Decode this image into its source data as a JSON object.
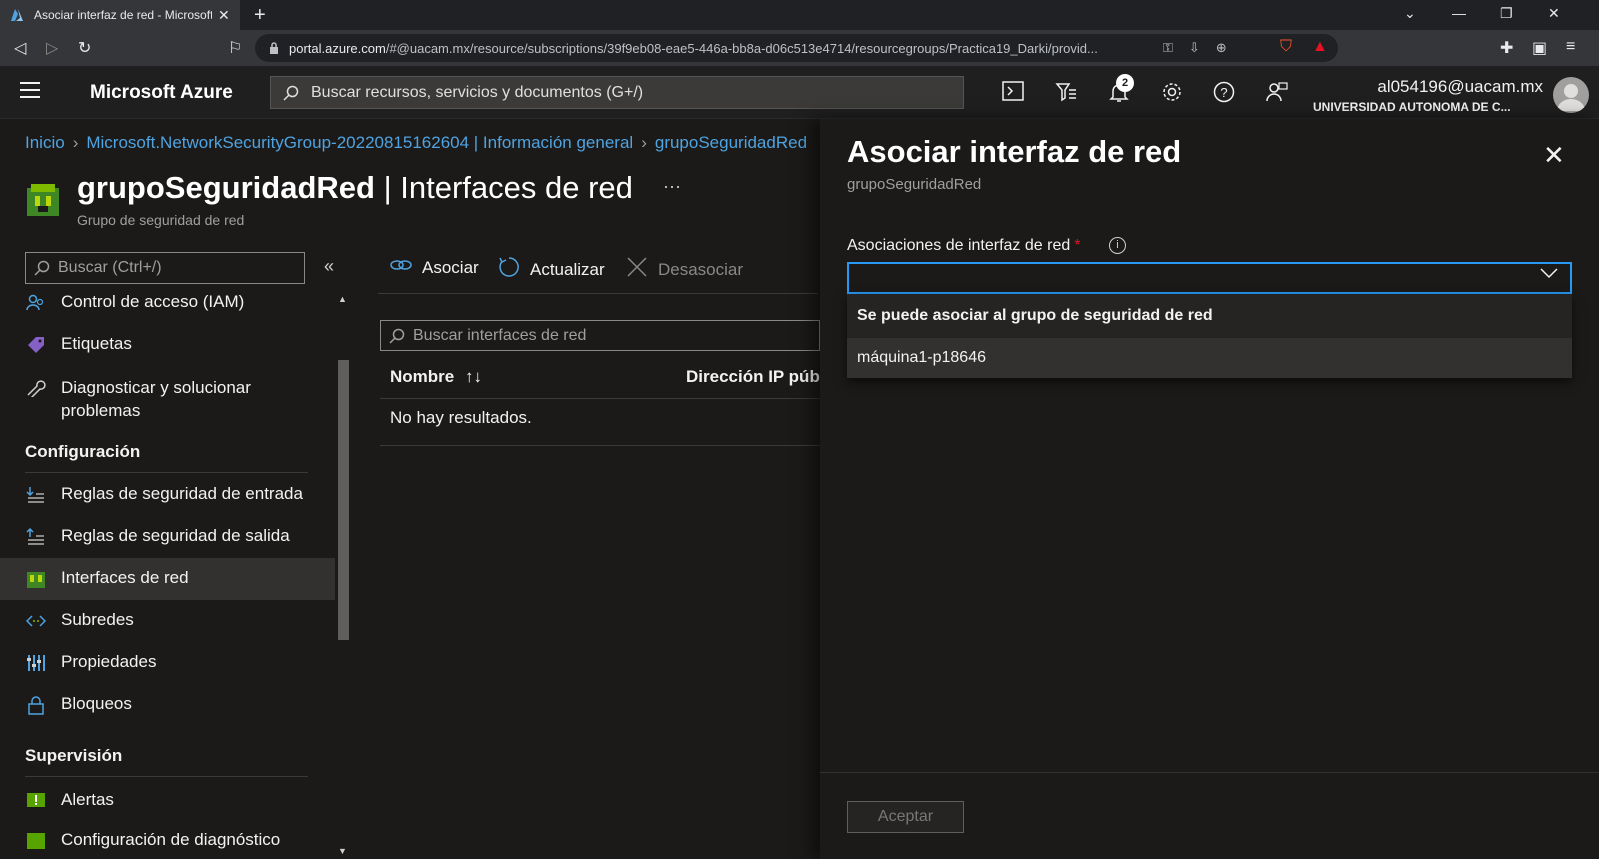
{
  "browser": {
    "tab_title": "Asociar interfaz de red - Microsoft Azure",
    "url_host": "portal.azure.com",
    "url_rest": "/#@uacam.mx/resource/subscriptions/39f9eb08-eae5-446a-bb8a-d06c513e4714/resourcegroups/Practica19_Darki/provid..."
  },
  "header": {
    "brand": "Microsoft Azure",
    "search_placeholder": "Buscar recursos, servicios y documentos (G+/)",
    "notifications_count": "2",
    "user_email": "al054196@uacam.mx",
    "user_org": "UNIVERSIDAD AUTONOMA DE C..."
  },
  "breadcrumb": {
    "items": [
      "Inicio",
      "Microsoft.NetworkSecurityGroup-20220815162604 | Información general",
      "grupoSeguridadRed"
    ]
  },
  "page": {
    "title_bold": "grupoSeguridadRed",
    "title_rest": " | Interfaces de red",
    "subtitle": "Grupo de seguridad de red",
    "more": "···"
  },
  "nav": {
    "search_placeholder": "Buscar (Ctrl+/)",
    "items": {
      "iam": "Control de acceso (IAM)",
      "tags": "Etiquetas",
      "diagnose": "Diagnosticar y solucionar problemas",
      "section_config": "Configuración",
      "inbound": "Reglas de seguridad de entrada",
      "outbound": "Reglas de seguridad de salida",
      "nics": "Interfaces de red",
      "subnets": "Subredes",
      "properties": "Propiedades",
      "locks": "Bloqueos",
      "section_monitor": "Supervisión",
      "alerts": "Alertas",
      "diag_settings": "Configuración de diagnóstico"
    }
  },
  "toolbar": {
    "associate": "Asociar",
    "refresh": "Actualizar",
    "disassociate": "Desasociar"
  },
  "grid": {
    "filter_placeholder": "Buscar interfaces de red",
    "col_name": "Nombre",
    "col_ip": "Dirección IP pública",
    "empty": "No hay resultados."
  },
  "panel": {
    "title": "Asociar interfaz de red",
    "subtitle": "grupoSeguridadRed",
    "field_label": "Asociaciones de interfaz de red",
    "required_mark": "*",
    "dropdown_group": "Se puede asociar al grupo de seguridad de red",
    "dropdown_option": "máquina1-p18646",
    "accept": "Aceptar"
  },
  "colors": {
    "accent": "#2899f5",
    "link": "#4fa3e0",
    "background": "#1b1a19"
  }
}
